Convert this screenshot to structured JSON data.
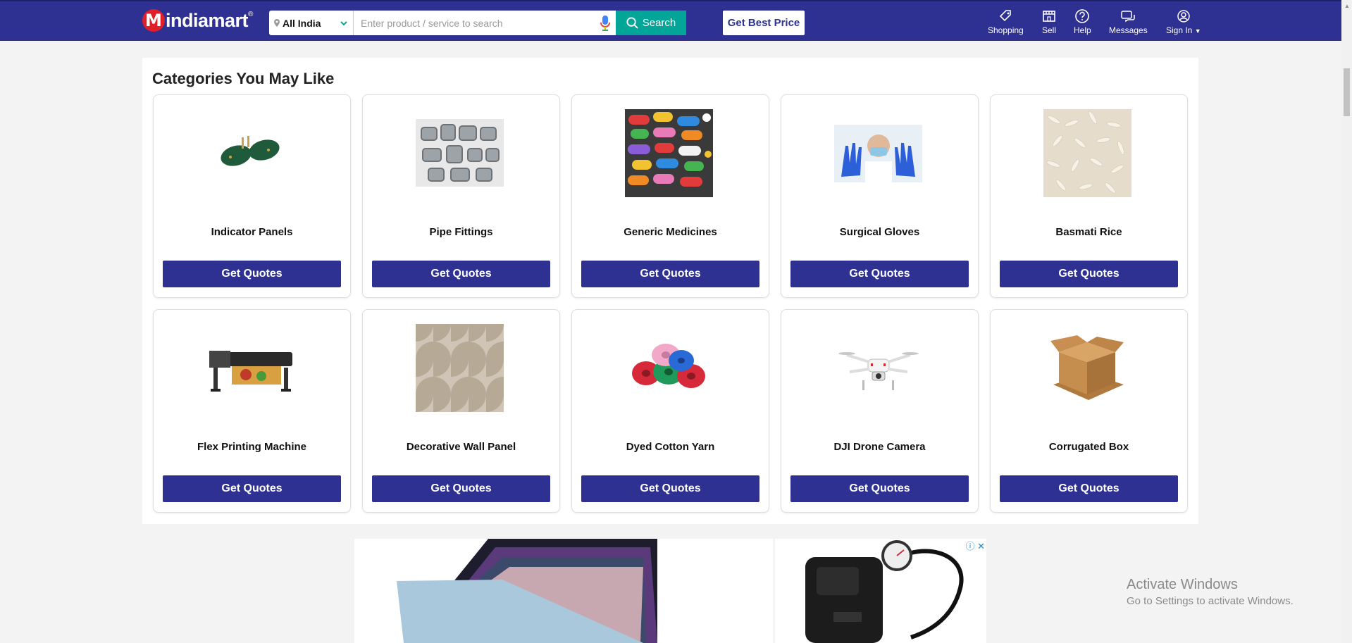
{
  "header": {
    "logo_text": "indiamart",
    "logo_reg": "®",
    "location": "All India",
    "search_placeholder": "Enter product / service to search",
    "search_label": "Search",
    "best_price_label": "Get Best Price",
    "nav": [
      {
        "label": "Shopping",
        "icon": "tag-icon"
      },
      {
        "label": "Sell",
        "icon": "store-icon"
      },
      {
        "label": "Help",
        "icon": "help-icon"
      },
      {
        "label": "Messages",
        "icon": "messages-icon"
      },
      {
        "label": "Sign In",
        "icon": "user-icon"
      }
    ],
    "colors": {
      "brand": "#2e3192",
      "search": "#02a699",
      "logo_red": "#e01f26"
    }
  },
  "main": {
    "title": "Categories You May Like",
    "button_label": "Get Quotes",
    "categories": [
      {
        "name": "Indicator Panels",
        "icon": "circuit-board-image"
      },
      {
        "name": "Pipe Fittings",
        "icon": "pipe-fittings-image"
      },
      {
        "name": "Generic Medicines",
        "icon": "capsules-image"
      },
      {
        "name": "Surgical Gloves",
        "icon": "surgical-gloves-image"
      },
      {
        "name": "Basmati Rice",
        "icon": "rice-image"
      },
      {
        "name": "Flex Printing Machine",
        "icon": "printer-machine-image"
      },
      {
        "name": "Decorative Wall Panel",
        "icon": "wall-panel-image"
      },
      {
        "name": "Dyed Cotton Yarn",
        "icon": "yarn-image"
      },
      {
        "name": "DJI Drone Camera",
        "icon": "drone-image"
      },
      {
        "name": "Corrugated Box",
        "icon": "cardboard-box-image"
      }
    ]
  },
  "ad": {
    "close": "ⓘ ✕",
    "left_icon": "fabric-swatches-image",
    "right_icon": "air-compressor-image"
  },
  "watermark": {
    "title": "Activate Windows",
    "subtitle": "Go to Settings to activate Windows."
  }
}
